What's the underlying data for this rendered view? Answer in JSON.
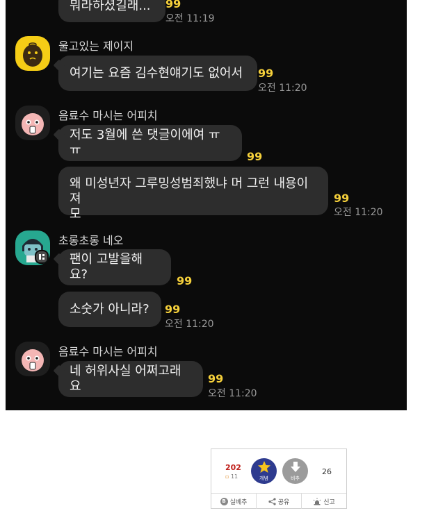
{
  "chat": {
    "messages": [
      {
        "text": "뭐라하셨길래...",
        "count": "99",
        "time": "오전 11:19"
      },
      {
        "sender": "울고있는 제이지",
        "text": "여기는 요즘 김수현얘기도 없어서",
        "count": "99",
        "time": "오전 11:20"
      },
      {
        "sender": "음료수 마시는 어피치",
        "text": "저도 3월에 쓴 댓글이에여 ㅠㅠ",
        "count": "99"
      },
      {
        "text": "왜 미성년자 그루밍성범죄했냐 머 그런 내용이져\n모",
        "count": "99",
        "time": "오전 11:20"
      },
      {
        "sender": "초롱초롱 네오",
        "text": "팬이 고발을해요?",
        "count": "99"
      },
      {
        "text": "소숫가 아니라?",
        "count": "99",
        "time": "오전 11:20"
      },
      {
        "sender": "음료수 마시는 어피치",
        "text": "네 허위사실 어쩌고래요",
        "count": "99",
        "time": "오전 11:20"
      }
    ]
  },
  "recommend": {
    "up_count": "202",
    "fixed_count": "11",
    "up_label": "개념",
    "down_label": "비추",
    "down_count": "26",
    "actions": [
      "실베추",
      "공유",
      "신고"
    ]
  },
  "colors": {
    "chat_bg": "#0b0b0b",
    "bubble_bg": "#2d2d2d",
    "count_color": "#f5d03b",
    "up_button": "#2e3b8f",
    "down_button": "#9b9b9b",
    "up_count_color": "#c0231e"
  },
  "icons": [
    "ryan-avatar-icon",
    "apeach-avatar-icon",
    "neo-avatar-icon",
    "star-icon",
    "down-arrow-icon",
    "b-icon",
    "share-icon",
    "siren-icon"
  ]
}
